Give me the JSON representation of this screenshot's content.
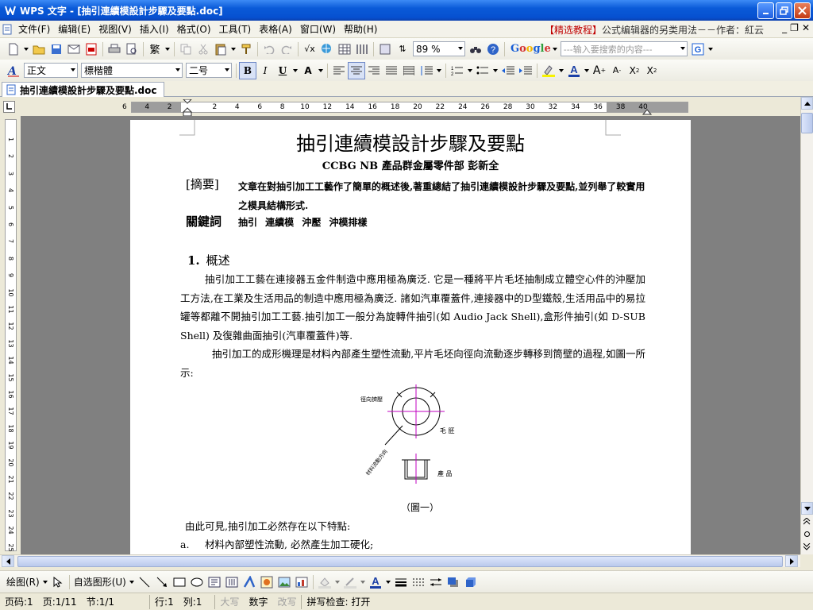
{
  "window": {
    "title": "WPS 文字 - [抽引連續模設計步驟及要點.doc]",
    "promo_bracket": "【精选教程】",
    "promo_text": "公式编辑器的另类用法－－作者：紅云"
  },
  "menubar": {
    "items": [
      "文件(F)",
      "编辑(E)",
      "视图(V)",
      "插入(I)",
      "格式(O)",
      "工具(T)",
      "表格(A)",
      "窗口(W)",
      "帮助(H)"
    ]
  },
  "toolbar1": {
    "zoom": "89 %",
    "search_placeholder": "---输入要搜索的内容---",
    "google_label": "Google"
  },
  "toolbar2": {
    "style": "正文",
    "font": "標楷體",
    "size": "二号",
    "bold": "B",
    "italic": "I",
    "underline": "U"
  },
  "doctab": {
    "label": "抽引連續模設計步驟及要點.doc"
  },
  "ruler": {
    "h_ticks": [
      "6",
      "4",
      "2",
      "2",
      "4",
      "6",
      "8",
      "10",
      "12",
      "14",
      "16",
      "18",
      "20",
      "22",
      "24",
      "26",
      "28",
      "30",
      "32",
      "34",
      "36",
      "38",
      "40"
    ],
    "v_ticks": [
      "1",
      "2",
      "3",
      "4",
      "5",
      "6",
      "7",
      "8",
      "9",
      "10",
      "11",
      "12",
      "13",
      "14",
      "15",
      "16",
      "17",
      "18",
      "19",
      "20",
      "21",
      "22",
      "23",
      "24",
      "25"
    ]
  },
  "document": {
    "title": "抽引連續模設計步驟及要點",
    "subtitle": "CCBG NB 產品群金屬零件部 彭新全",
    "abstract_label": "[摘要]",
    "abstract_text": "文章在對抽引加工工藝作了簡單的概述後,著重總結了抽引連續模設計步驟及要點,並列舉了較實用之模具結構形式.",
    "keywords_label": "關鍵詞",
    "keywords": "抽引 連續模 沖壓 沖模排樣",
    "section_num": "1.",
    "section_title": "概述",
    "para1": "抽引加工工藝在連接器五金件制造中應用極為廣泛. 它是一種將平片毛坯抽制成立體空心件的沖壓加工方法,在工業及生活用品的制造中應用極為廣泛. 諸如汽車覆蓋件,連接器中的D型鐵殼,生活用品中的易拉罐等都離不開抽引加工工藝.抽引加工一般分為旋轉件抽引(如 Audio Jack Shell),盒形件抽引(如 D-SUB Shell) 及復雜曲面抽引(汽車覆蓋件)等.",
    "para2": "抽引加工的成形機理是材料內部產生塑性流動,平片毛坯向徑向流動逐步轉移到筒壁的過程,如圖一所示:",
    "fig_label_radial": "徑向擠壓",
    "fig_label_flow": "材料流動方向",
    "fig_label_blank": "毛 胚",
    "fig_label_product": "產 品",
    "fig_caption": "（圖一）",
    "line_a": "由此可見,抽引加工必然存在以下特點:",
    "line_b_marker": "a.",
    "line_b_text": "材料內部塑性流動, 必然產生加工硬化;"
  },
  "drawbar": {
    "draw_label": "绘图(R)",
    "autoshape_label": "自选图形(U)"
  },
  "statusbar": {
    "page_code": "页码:1",
    "page": "页:1/11",
    "section": "节:1/1",
    "row": "行:1",
    "col": "列:1",
    "caps": "大写",
    "num": "数字",
    "ovr": "改写",
    "spell": "拼写检查: 打开"
  }
}
